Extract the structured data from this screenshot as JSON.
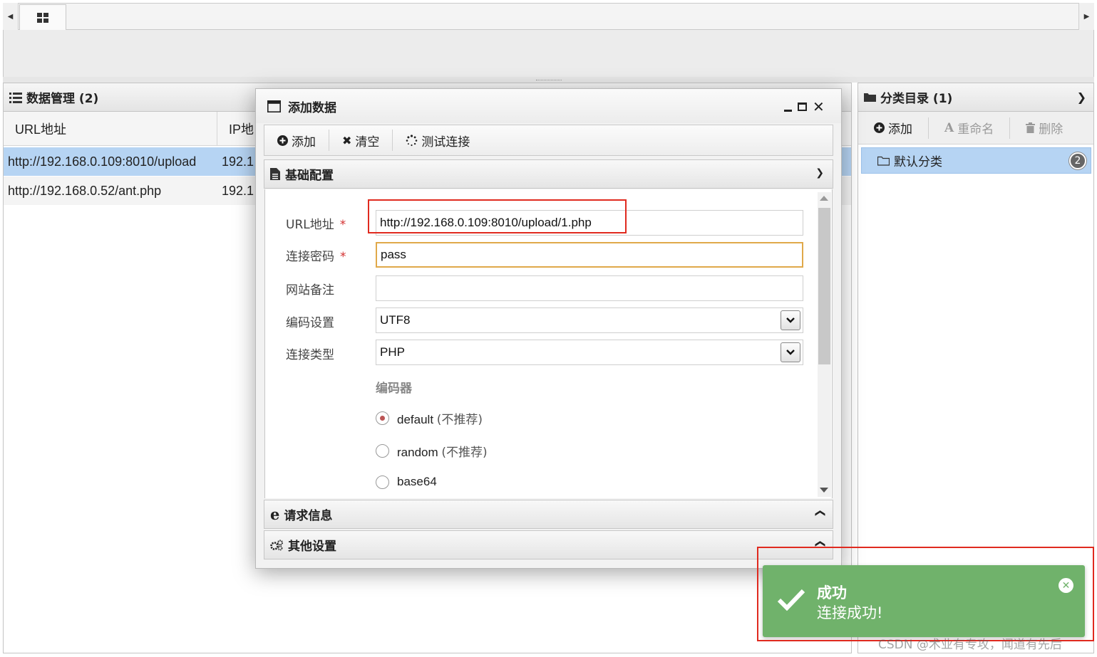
{
  "left_panel": {
    "title": "数据管理 (2)",
    "columns": [
      "URL地址",
      "IP地"
    ],
    "rows": [
      {
        "url": "http://192.168.0.109:8010/upload",
        "ip": "192.1"
      },
      {
        "url": "http://192.168.0.52/ant.php",
        "ip": "192.1"
      }
    ]
  },
  "right_panel": {
    "title": "分类目录 (1)",
    "toolbar": {
      "add": "添加",
      "rename": "重命名",
      "delete": "删除"
    },
    "categories": [
      {
        "name": "默认分类",
        "count": "2"
      }
    ]
  },
  "dialog": {
    "title": "添加数据",
    "toolbar": {
      "add": "添加",
      "clear": "清空",
      "test": "测试连接"
    },
    "sections": {
      "basic": "基础配置",
      "request": "请求信息",
      "other": "其他设置"
    },
    "fields": {
      "url_label": "URL地址",
      "url_value": "http://192.168.0.109:8010/upload/1.php",
      "password_label": "连接密码",
      "password_value": "pass",
      "note_label": "网站备注",
      "note_value": "",
      "encoding_label": "编码设置",
      "encoding_value": "UTF8",
      "type_label": "连接类型",
      "type_value": "PHP",
      "required_mark": "*"
    },
    "encoder": {
      "label": "编码器",
      "options": [
        {
          "name": "default",
          "note": "(不推荐)",
          "selected": true
        },
        {
          "name": "random",
          "note": "(不推荐)",
          "selected": false
        },
        {
          "name": "base64",
          "note": "",
          "selected": false
        }
      ]
    }
  },
  "toast": {
    "title": "成功",
    "message": "连接成功!",
    "color": "#70b26b"
  },
  "watermark": "CSDN @术业有专攻，闻道有先后",
  "colors": {
    "selection": "#b6d4f3",
    "annotation": "#e02a1f",
    "focus": "#e0a94a"
  }
}
